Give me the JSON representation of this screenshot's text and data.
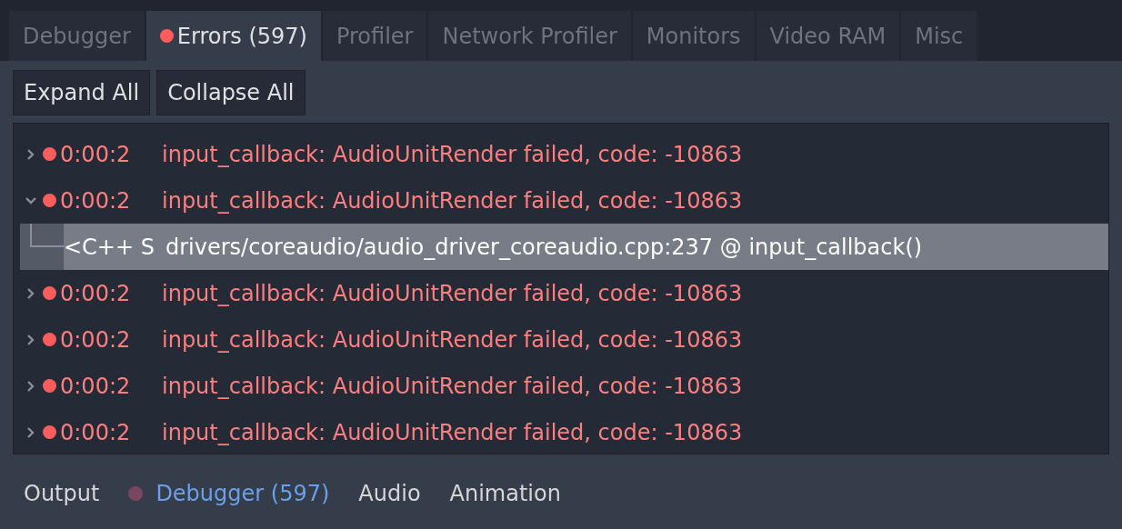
{
  "tabs": [
    {
      "label": "Debugger",
      "selected": false,
      "alert": false
    },
    {
      "label": "Errors (597)",
      "selected": true,
      "alert": true
    },
    {
      "label": "Profiler",
      "selected": false,
      "alert": false
    },
    {
      "label": "Network Profiler",
      "selected": false,
      "alert": false
    },
    {
      "label": "Monitors",
      "selected": false,
      "alert": false
    },
    {
      "label": "Video RAM",
      "selected": false,
      "alert": false
    },
    {
      "label": "Misc",
      "selected": false,
      "alert": false
    }
  ],
  "buttons": [
    "Expand All",
    "Collapse All"
  ],
  "errors": [
    {
      "time": "0:00:2",
      "message": "input_callback: AudioUnitRender failed, code: -10863",
      "expanded": false
    },
    {
      "time": "0:00:2",
      "message": "input_callback: AudioUnitRender failed, code: -10863",
      "expanded": true,
      "children": [
        {
          "source": "<C++ S",
          "location": "drivers/coreaudio/audio_driver_coreaudio.cpp:237 @ input_callback()",
          "selected": true
        }
      ]
    },
    {
      "time": "0:00:2",
      "message": "input_callback: AudioUnitRender failed, code: -10863",
      "expanded": false
    },
    {
      "time": "0:00:2",
      "message": "input_callback: AudioUnitRender failed, code: -10863",
      "expanded": false
    },
    {
      "time": "0:00:2",
      "message": "input_callback: AudioUnitRender failed, code: -10863",
      "expanded": false
    },
    {
      "time": "0:00:2",
      "message": "input_callback: AudioUnitRender failed, code: -10863",
      "expanded": false
    }
  ],
  "bottom_tabs": [
    {
      "label": "Output",
      "selected": false,
      "alert": false
    },
    {
      "label": "Debugger (597)",
      "selected": true,
      "alert": true
    },
    {
      "label": "Audio",
      "selected": false,
      "alert": false
    },
    {
      "label": "Animation",
      "selected": false,
      "alert": false
    }
  ]
}
